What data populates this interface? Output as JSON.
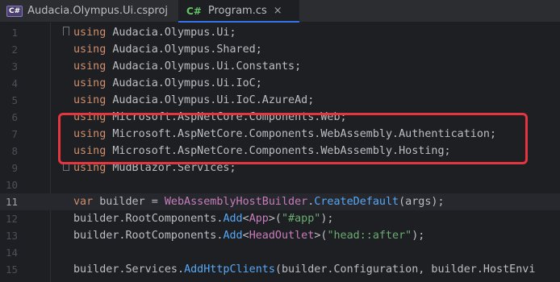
{
  "tabs": [
    {
      "icon_label": "C#",
      "icon": "csproj-file-icon",
      "title": "Audacia.Olympus.Ui.csproj",
      "active": false
    },
    {
      "icon_label": "C#",
      "icon": "csharp-file-icon",
      "title": "Program.cs",
      "active": true
    }
  ],
  "close_glyph": "×",
  "lines": [
    {
      "n": "1",
      "tokens": [
        [
          "kw",
          "using "
        ],
        [
          "plain",
          "Audacia.Olympus.Ui;"
        ]
      ]
    },
    {
      "n": "2",
      "tokens": [
        [
          "kw",
          "using "
        ],
        [
          "plain",
          "Audacia.Olympus.Shared;"
        ]
      ]
    },
    {
      "n": "3",
      "tokens": [
        [
          "kw",
          "using "
        ],
        [
          "plain",
          "Audacia.Olympus.Ui.Constants;"
        ]
      ]
    },
    {
      "n": "4",
      "tokens": [
        [
          "kw",
          "using "
        ],
        [
          "plain",
          "Audacia.Olympus.Ui.IoC;"
        ]
      ]
    },
    {
      "n": "5",
      "tokens": [
        [
          "kw",
          "using "
        ],
        [
          "plain",
          "Audacia.Olympus.Ui.IoC.AzureAd;"
        ]
      ]
    },
    {
      "n": "6",
      "tokens": [
        [
          "kw",
          "using "
        ],
        [
          "plain",
          "Microsoft.AspNetCore.Components.Web;"
        ]
      ]
    },
    {
      "n": "7",
      "tokens": [
        [
          "kw",
          "using "
        ],
        [
          "plain",
          "Microsoft.AspNetCore.Components.WebAssembly.Authentication;"
        ]
      ]
    },
    {
      "n": "8",
      "tokens": [
        [
          "kw",
          "using "
        ],
        [
          "plain",
          "Microsoft.AspNetCore.Components.WebAssembly.Hosting;"
        ]
      ]
    },
    {
      "n": "9",
      "tokens": [
        [
          "kw",
          "using "
        ],
        [
          "plain",
          "MudBlazor.Services;"
        ]
      ]
    },
    {
      "n": "10",
      "tokens": []
    },
    {
      "n": "11",
      "tokens": [
        [
          "kw",
          "var "
        ],
        [
          "plain",
          "builder = "
        ],
        [
          "cls",
          "WebAssemblyHostBuilder"
        ],
        [
          "plain",
          "."
        ],
        [
          "fn",
          "CreateDefault"
        ],
        [
          "plain",
          "(args);"
        ]
      ]
    },
    {
      "n": "12",
      "tokens": [
        [
          "plain",
          "builder.RootComponents."
        ],
        [
          "fn",
          "Add"
        ],
        [
          "plain",
          "<"
        ],
        [
          "cls",
          "App"
        ],
        [
          "plain",
          ">("
        ],
        [
          "str",
          "\"#app\""
        ],
        [
          "plain",
          ");"
        ]
      ]
    },
    {
      "n": "13",
      "tokens": [
        [
          "plain",
          "builder.RootComponents."
        ],
        [
          "fn",
          "Add"
        ],
        [
          "plain",
          "<"
        ],
        [
          "cls",
          "HeadOutlet"
        ],
        [
          "plain",
          ">("
        ],
        [
          "str",
          "\"head::after\""
        ],
        [
          "plain",
          ");"
        ]
      ]
    },
    {
      "n": "14",
      "tokens": []
    },
    {
      "n": "15",
      "tokens": [
        [
          "plain",
          "builder.Services."
        ],
        [
          "fn",
          "AddHttpClients"
        ],
        [
          "plain",
          "(builder.Configuration, builder.HostEnvi"
        ]
      ]
    }
  ],
  "current_line": "11",
  "highlight_color": "#e5353e",
  "accent_color": "#3574f0"
}
